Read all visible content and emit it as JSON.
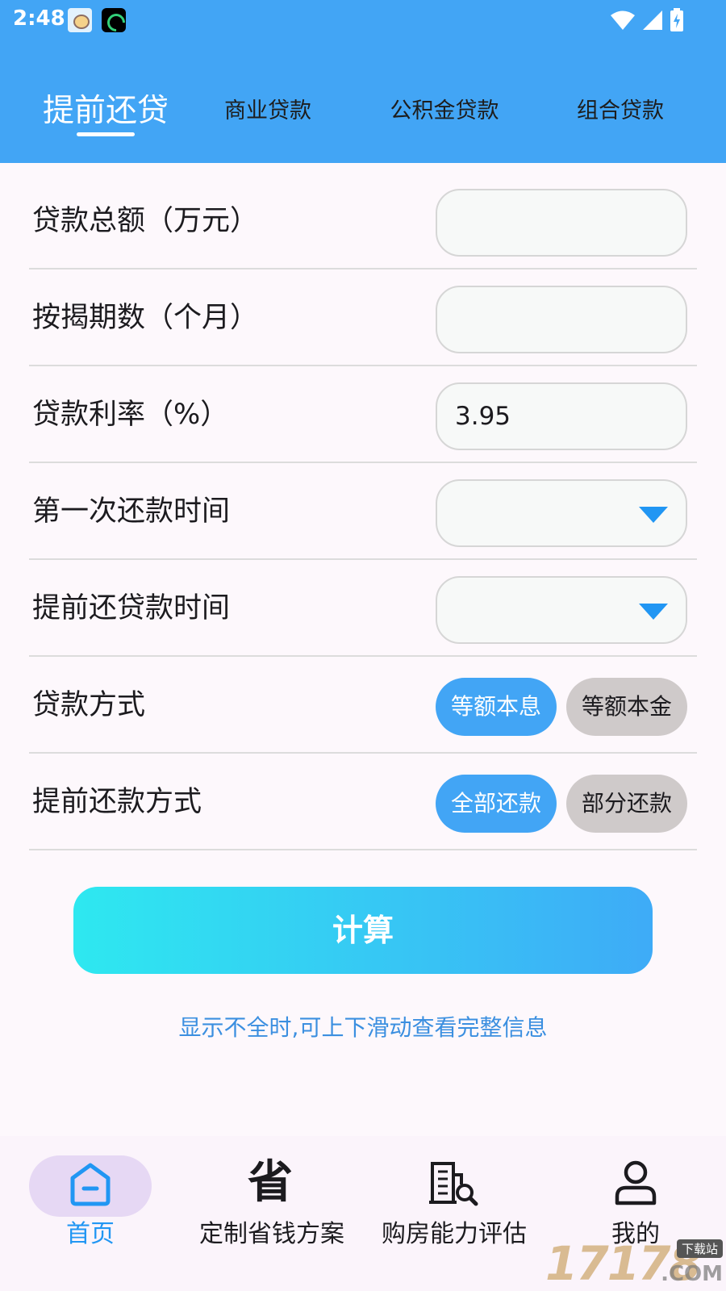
{
  "status_bar": {
    "time": "2:48",
    "icons": [
      "app-notification-icon",
      "sleep-app-icon",
      "wifi-icon",
      "cell-signal-icon",
      "battery-charging-icon"
    ]
  },
  "tabs": [
    {
      "label": "提前还贷",
      "active": true
    },
    {
      "label": "商业贷款",
      "active": false
    },
    {
      "label": "公积金贷款",
      "active": false
    },
    {
      "label": "组合贷款",
      "active": false
    }
  ],
  "form": {
    "loan_total": {
      "label": "贷款总额（万元）",
      "value": ""
    },
    "months": {
      "label": "按揭期数（个月）",
      "value": ""
    },
    "rate": {
      "label": "贷款利率（%）",
      "value": "3.95"
    },
    "first_payment": {
      "label": "第一次还款时间",
      "value": ""
    },
    "prepay_time": {
      "label": "提前还贷款时间",
      "value": ""
    },
    "loan_method": {
      "label": "贷款方式",
      "options": [
        "等额本息",
        "等额本金"
      ],
      "selected": "等额本息"
    },
    "prepay_method": {
      "label": "提前还款方式",
      "options": [
        "全部还款",
        "部分还款"
      ],
      "selected": "全部还款"
    }
  },
  "calculate_label": "计算",
  "hint": "显示不全时,可上下滑动查看完整信息",
  "bottom_nav": [
    {
      "label": "首页",
      "icon": "home-icon",
      "active": true
    },
    {
      "label": "定制省钱方案",
      "icon": "sheng-char-icon",
      "icon_text": "省",
      "active": false
    },
    {
      "label": "购房能力评估",
      "icon": "building-search-icon",
      "active": false
    },
    {
      "label": "我的",
      "icon": "person-icon",
      "active": false
    }
  ],
  "watermark": {
    "number": "17178",
    "tag": "下载站",
    "suffix": ".COM"
  },
  "colors": {
    "primary": "#42a5f5",
    "accent": "#2196f3",
    "inactive_pill": "#cfcaca",
    "gradient_start": "#2ee8f0",
    "gradient_end": "#3eabf7"
  }
}
